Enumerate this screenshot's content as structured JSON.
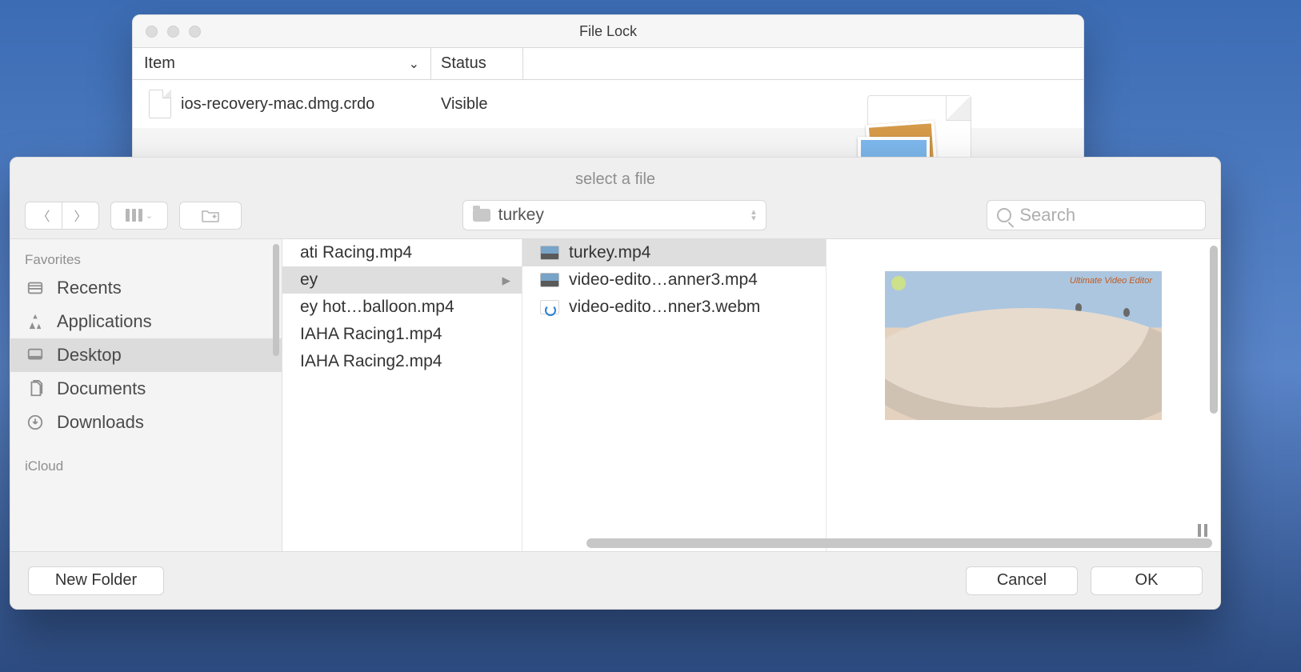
{
  "backWindow": {
    "title": "File Lock",
    "columns": {
      "item": "Item",
      "status": "Status"
    },
    "row": {
      "name": "ios-recovery-mac.dmg.crdo",
      "status": "Visible"
    }
  },
  "dialog": {
    "title": "select a file",
    "location": "turkey",
    "search_placeholder": "Search",
    "sidebar": {
      "favorites_label": "Favorites",
      "icloud_label": "iCloud",
      "items": [
        {
          "label": "Recents"
        },
        {
          "label": "Applications"
        },
        {
          "label": "Desktop"
        },
        {
          "label": "Documents"
        },
        {
          "label": "Downloads"
        }
      ]
    },
    "column1": [
      {
        "label": "ati Racing.mp4",
        "kind": "file"
      },
      {
        "label": "ey",
        "kind": "folder"
      },
      {
        "label": "ey hot…balloon.mp4",
        "kind": "file"
      },
      {
        "label": "IAHA Racing1.mp4",
        "kind": "file"
      },
      {
        "label": "IAHA Racing2.mp4",
        "kind": "file"
      }
    ],
    "column2": [
      {
        "label": "turkey.mp4",
        "kind": "video"
      },
      {
        "label": "video-edito…anner3.mp4",
        "kind": "video"
      },
      {
        "label": "video-edito…nner3.webm",
        "kind": "webm"
      }
    ],
    "preview_overlay_title": "Ultimate Video Editor",
    "footer": {
      "new_folder": "New Folder",
      "cancel": "Cancel",
      "ok": "OK"
    }
  }
}
